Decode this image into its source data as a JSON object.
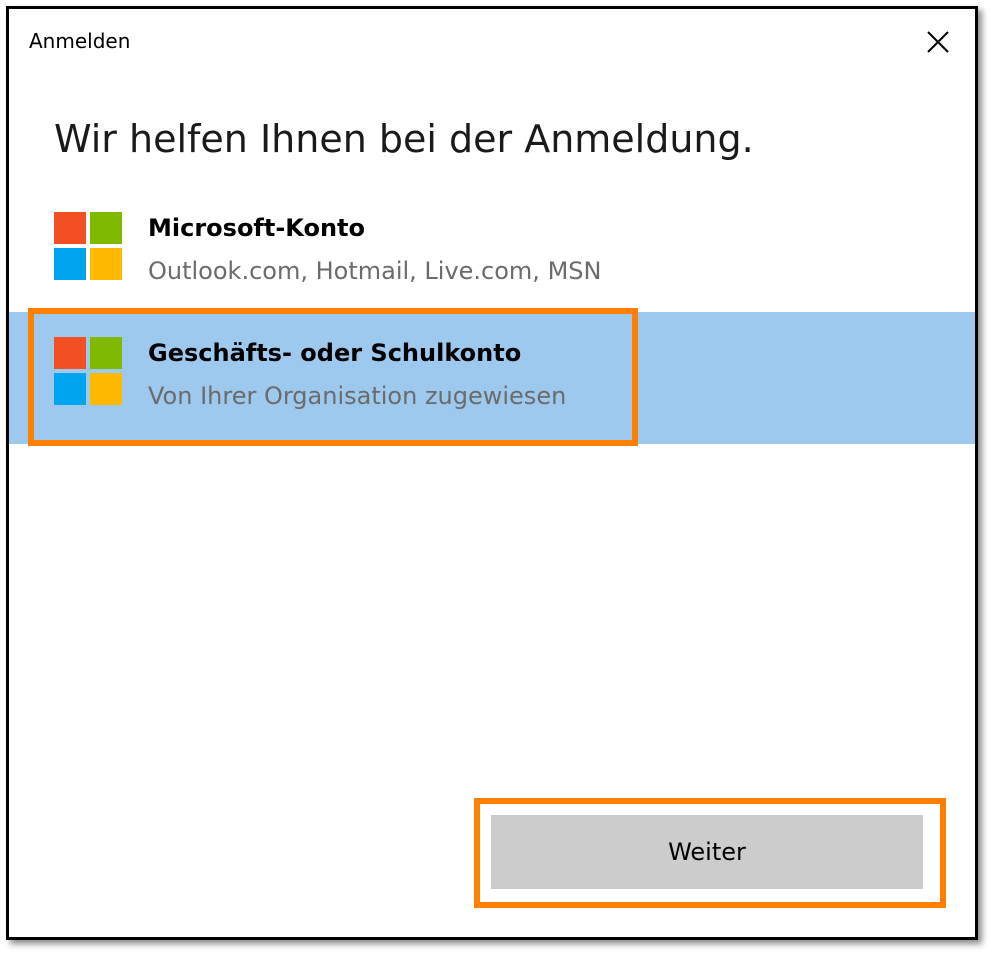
{
  "window": {
    "title": "Anmelden",
    "close_icon": "close-icon"
  },
  "heading": "Wir helfen Ihnen bei der Anmeldung.",
  "options": [
    {
      "title": "Microsoft-Konto",
      "subtitle": "Outlook.com, Hotmail, Live.com, MSN",
      "icon": "microsoft-logo-icon",
      "selected": false
    },
    {
      "title": "Geschäfts- oder Schulkonto",
      "subtitle": "Von Ihrer Organisation zugewiesen",
      "icon": "microsoft-logo-icon",
      "selected": true
    }
  ],
  "next_button": {
    "label": "Weiter"
  },
  "colors": {
    "selection_background": "#9dc9ee",
    "highlight_outline": "#ff8000",
    "button_background": "#cccccc",
    "logo_red": "#f25022",
    "logo_green": "#7fba00",
    "logo_blue": "#00a4ef",
    "logo_yellow": "#ffb900"
  }
}
